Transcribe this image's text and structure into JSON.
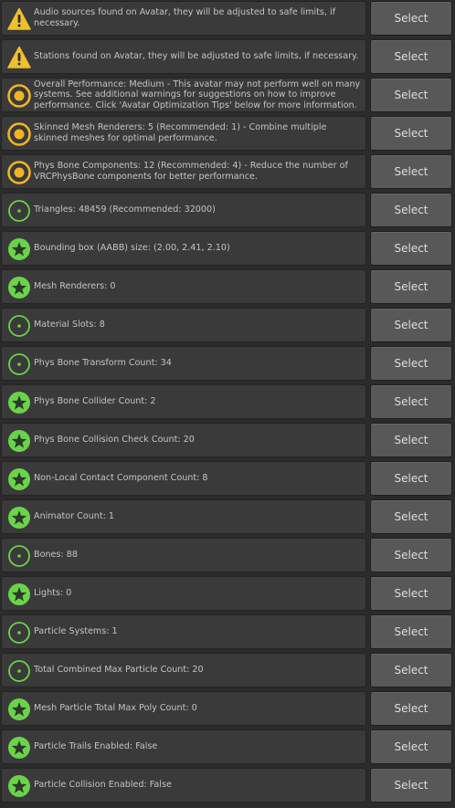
{
  "colors": {
    "warning": "#f0c02c",
    "medium": "#f0b521",
    "good": "#6ad34a"
  },
  "rows": [
    {
      "icon": "warning-icon",
      "text": "Audio sources found on Avatar, they will be adjusted to safe limits, if necessary.",
      "button": "Select"
    },
    {
      "icon": "warning-icon",
      "text": "Stations found on Avatar, they will be adjusted to safe limits, if necessary.",
      "button": "Select"
    },
    {
      "icon": "medium-performance-icon",
      "text": "Overall Performance: Medium - This avatar may not perform well on many systems. See additional warnings for suggestions on how to improve performance. Click 'Avatar Optimization Tips' below for more information.",
      "button": "Select"
    },
    {
      "icon": "medium-performance-icon",
      "text": "Skinned Mesh Renderers: 5 (Recommended: 1) - Combine multiple skinned meshes for optimal performance.",
      "button": "Select"
    },
    {
      "icon": "medium-performance-icon",
      "text": "Phys Bone Components: 12 (Recommended: 4) - Reduce the number of VRCPhysBone components for better performance.",
      "button": "Select"
    },
    {
      "icon": "good-performance-icon",
      "text": "Triangles: 48459 (Recommended: 32000)",
      "button": "Select"
    },
    {
      "icon": "excellent-star-icon",
      "text": "Bounding box (AABB) size: (2.00, 2.41, 2.10)",
      "button": "Select"
    },
    {
      "icon": "excellent-star-icon",
      "text": "Mesh Renderers: 0",
      "button": "Select"
    },
    {
      "icon": "good-performance-icon",
      "text": "Material Slots: 8",
      "button": "Select"
    },
    {
      "icon": "good-performance-icon",
      "text": "Phys Bone Transform Count: 34",
      "button": "Select"
    },
    {
      "icon": "excellent-star-icon",
      "text": "Phys Bone Collider Count: 2",
      "button": "Select"
    },
    {
      "icon": "excellent-star-icon",
      "text": "Phys Bone Collision Check Count: 20",
      "button": "Select"
    },
    {
      "icon": "excellent-star-icon",
      "text": "Non-Local Contact Component Count: 8",
      "button": "Select"
    },
    {
      "icon": "excellent-star-icon",
      "text": "Animator Count: 1",
      "button": "Select"
    },
    {
      "icon": "good-performance-icon",
      "text": "Bones: 88",
      "button": "Select"
    },
    {
      "icon": "excellent-star-icon",
      "text": "Lights: 0",
      "button": "Select"
    },
    {
      "icon": "good-performance-icon",
      "text": "Particle Systems: 1",
      "button": "Select"
    },
    {
      "icon": "good-performance-icon",
      "text": "Total Combined Max Particle Count: 20",
      "button": "Select"
    },
    {
      "icon": "excellent-star-icon",
      "text": "Mesh Particle Total Max Poly Count: 0",
      "button": "Select"
    },
    {
      "icon": "excellent-star-icon",
      "text": "Particle Trails Enabled: False",
      "button": "Select"
    },
    {
      "icon": "excellent-star-icon",
      "text": "Particle Collision Enabled: False",
      "button": "Select"
    }
  ]
}
